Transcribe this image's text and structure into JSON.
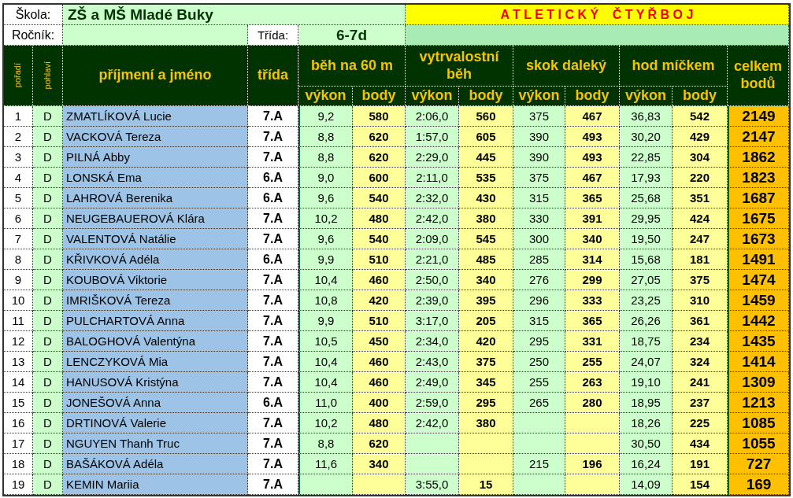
{
  "school": {
    "label": "Škola:",
    "value": "ZŠ a MŠ Mladé Buky"
  },
  "title": "A T L E T I C K Ý    Č T Y Ř B O J",
  "grade": {
    "label": "Ročník:"
  },
  "class": {
    "label": "Třída:",
    "value": "6-7d"
  },
  "header": {
    "rank": "pořadí",
    "gender": "pohlaví",
    "name": "příjmení a jméno",
    "class": "třída",
    "total": "celkem bodů"
  },
  "events": [
    {
      "name": "běh na 60 m",
      "performance": "výkon",
      "points": "body"
    },
    {
      "name": "vytrvalostní běh",
      "performance": "výkon",
      "points": "body"
    },
    {
      "name": "skok daleký",
      "performance": "výkon",
      "points": "body"
    },
    {
      "name": "hod míčkem",
      "performance": "výkon",
      "points": "body"
    }
  ],
  "rows": [
    {
      "rank": "1",
      "gender": "D",
      "name": "ZMATLÍKOVÁ Lucie",
      "class": "7.A",
      "sprint": {
        "performance": "9,2",
        "points": "580"
      },
      "endurance": {
        "performance": "2:06,0",
        "points": "560"
      },
      "long_jump": {
        "performance": "375",
        "points": "467"
      },
      "ball_throw": {
        "performance": "36,83",
        "points": "542"
      },
      "total": "2149"
    },
    {
      "rank": "2",
      "gender": "D",
      "name": "VACKOVÁ Tereza",
      "class": "7.A",
      "sprint": {
        "performance": "8,8",
        "points": "620"
      },
      "endurance": {
        "performance": "1:57,0",
        "points": "605"
      },
      "long_jump": {
        "performance": "390",
        "points": "493"
      },
      "ball_throw": {
        "performance": "30,20",
        "points": "429"
      },
      "total": "2147"
    },
    {
      "rank": "3",
      "gender": "D",
      "name": "PILNÁ Abby",
      "class": "7.A",
      "sprint": {
        "performance": "8,8",
        "points": "620"
      },
      "endurance": {
        "performance": "2:29,0",
        "points": "445"
      },
      "long_jump": {
        "performance": "390",
        "points": "493"
      },
      "ball_throw": {
        "performance": "22,85",
        "points": "304"
      },
      "total": "1862"
    },
    {
      "rank": "4",
      "gender": "D",
      "name": "LONSKÁ Ema",
      "class": "6.A",
      "sprint": {
        "performance": "9,0",
        "points": "600"
      },
      "endurance": {
        "performance": "2:11,0",
        "points": "535"
      },
      "long_jump": {
        "performance": "375",
        "points": "467"
      },
      "ball_throw": {
        "performance": "17,93",
        "points": "220"
      },
      "total": "1823"
    },
    {
      "rank": "5",
      "gender": "D",
      "name": "LAHROVÁ Berenika",
      "class": "6.A",
      "sprint": {
        "performance": "9,6",
        "points": "540"
      },
      "endurance": {
        "performance": "2:32,0",
        "points": "430"
      },
      "long_jump": {
        "performance": "315",
        "points": "365"
      },
      "ball_throw": {
        "performance": "25,68",
        "points": "351"
      },
      "total": "1687"
    },
    {
      "rank": "6",
      "gender": "D",
      "name": "NEUGEBAUEROVÁ Klára",
      "class": "7.A",
      "sprint": {
        "performance": "10,2",
        "points": "480"
      },
      "endurance": {
        "performance": "2:42,0",
        "points": "380"
      },
      "long_jump": {
        "performance": "330",
        "points": "391"
      },
      "ball_throw": {
        "performance": "29,95",
        "points": "424"
      },
      "total": "1675"
    },
    {
      "rank": "7",
      "gender": "D",
      "name": "VALENTOVÁ Natálie",
      "class": "7.A",
      "sprint": {
        "performance": "9,6",
        "points": "540"
      },
      "endurance": {
        "performance": "2:09,0",
        "points": "545"
      },
      "long_jump": {
        "performance": "300",
        "points": "340"
      },
      "ball_throw": {
        "performance": "19,50",
        "points": "247"
      },
      "total": "1673"
    },
    {
      "rank": "8",
      "gender": "D",
      "name": "KŘIVKOVÁ Adéla",
      "class": "6.A",
      "sprint": {
        "performance": "9,9",
        "points": "510"
      },
      "endurance": {
        "performance": "2:21,0",
        "points": "485"
      },
      "long_jump": {
        "performance": "285",
        "points": "314"
      },
      "ball_throw": {
        "performance": "15,68",
        "points": "181"
      },
      "total": "1491"
    },
    {
      "rank": "9",
      "gender": "D",
      "name": "KOUBOVÁ Viktorie",
      "class": "7.A",
      "sprint": {
        "performance": "10,4",
        "points": "460"
      },
      "endurance": {
        "performance": "2:50,0",
        "points": "340"
      },
      "long_jump": {
        "performance": "276",
        "points": "299"
      },
      "ball_throw": {
        "performance": "27,05",
        "points": "375"
      },
      "total": "1474"
    },
    {
      "rank": "10",
      "gender": "D",
      "name": "IMRIŠKOVÁ Tereza",
      "class": "7.A",
      "sprint": {
        "performance": "10,8",
        "points": "420"
      },
      "endurance": {
        "performance": "2:39,0",
        "points": "395"
      },
      "long_jump": {
        "performance": "296",
        "points": "333"
      },
      "ball_throw": {
        "performance": "23,25",
        "points": "310"
      },
      "total": "1459"
    },
    {
      "rank": "11",
      "gender": "D",
      "name": "PULCHARTOVÁ Anna",
      "class": "7.A",
      "sprint": {
        "performance": "9,9",
        "points": "510"
      },
      "endurance": {
        "performance": "3:17,0",
        "points": "205"
      },
      "long_jump": {
        "performance": "315",
        "points": "365"
      },
      "ball_throw": {
        "performance": "26,26",
        "points": "361"
      },
      "total": "1442"
    },
    {
      "rank": "12",
      "gender": "D",
      "name": "BALOGHOVÁ Valentýna",
      "class": "7.A",
      "sprint": {
        "performance": "10,5",
        "points": "450"
      },
      "endurance": {
        "performance": "2:34,0",
        "points": "420"
      },
      "long_jump": {
        "performance": "295",
        "points": "331"
      },
      "ball_throw": {
        "performance": "18,75",
        "points": "234"
      },
      "total": "1435"
    },
    {
      "rank": "13",
      "gender": "D",
      "name": "LENCZYKOVÁ Mia",
      "class": "7.A",
      "sprint": {
        "performance": "10,4",
        "points": "460"
      },
      "endurance": {
        "performance": "2:43,0",
        "points": "375"
      },
      "long_jump": {
        "performance": "250",
        "points": "255"
      },
      "ball_throw": {
        "performance": "24,07",
        "points": "324"
      },
      "total": "1414"
    },
    {
      "rank": "14",
      "gender": "D",
      "name": "HANUSOVÁ Kristýna",
      "class": "7.A",
      "sprint": {
        "performance": "10,4",
        "points": "460"
      },
      "endurance": {
        "performance": "2:49,0",
        "points": "345"
      },
      "long_jump": {
        "performance": "255",
        "points": "263"
      },
      "ball_throw": {
        "performance": "19,10",
        "points": "241"
      },
      "total": "1309"
    },
    {
      "rank": "15",
      "gender": "D",
      "name": "JONEŠOVÁ Anna",
      "class": "6.A",
      "sprint": {
        "performance": "11,0",
        "points": "400"
      },
      "endurance": {
        "performance": "2:59,0",
        "points": "295"
      },
      "long_jump": {
        "performance": "265",
        "points": "280"
      },
      "ball_throw": {
        "performance": "18,95",
        "points": "237"
      },
      "total": "1213"
    },
    {
      "rank": "16",
      "gender": "D",
      "name": "DRTINOVÁ Valerie",
      "class": "7.A",
      "sprint": {
        "performance": "10,2",
        "points": "480"
      },
      "endurance": {
        "performance": "2:42,0",
        "points": "380"
      },
      "ball_throw": {
        "performance": "18,26",
        "points": "225"
      },
      "total": "1085"
    },
    {
      "rank": "17",
      "gender": "D",
      "name": "NGUYEN Thanh Truc",
      "class": "7.A",
      "sprint": {
        "performance": "8,8",
        "points": "620"
      },
      "ball_throw": {
        "performance": "30,50",
        "points": "434"
      },
      "total": "1055"
    },
    {
      "rank": "18",
      "gender": "D",
      "name": "BAŠÁKOVÁ Adéla",
      "class": "7.A",
      "sprint": {
        "performance": "11,6",
        "points": "340"
      },
      "long_jump": {
        "performance": "215",
        "points": "196"
      },
      "ball_throw": {
        "performance": "16,24",
        "points": "191"
      },
      "total": "727"
    },
    {
      "rank": "19",
      "gender": "D",
      "name": "KEMIN Mariia",
      "class": "7.A",
      "endurance": {
        "performance": "3:55,0",
        "points": "15"
      },
      "ball_throw": {
        "performance": "14,09",
        "points": "154"
      },
      "total": "169"
    }
  ]
}
